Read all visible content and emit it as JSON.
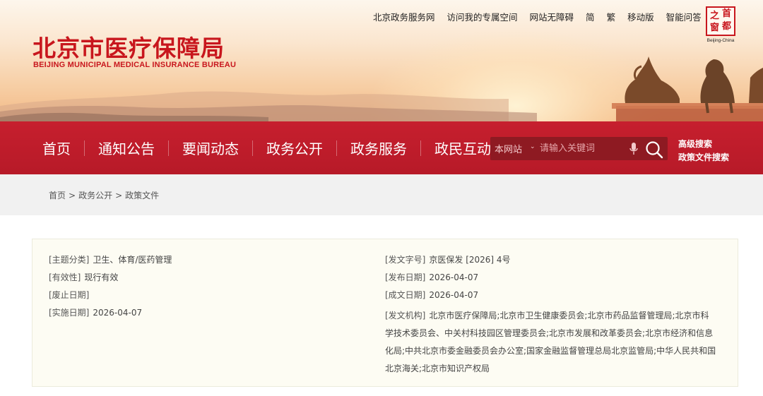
{
  "header": {
    "logo_cn": "北京市医疗保障局",
    "logo_en": "BEIJING MUNICIPAL MEDICAL INSURANCE BUREAU",
    "top_links": [
      "北京政务服务网",
      "访问我的专属空间",
      "网站无障碍",
      "简",
      "繁",
      "移动版",
      "智能问答"
    ],
    "seal": {
      "chars": [
        "首",
        "都",
        "之",
        "窗"
      ],
      "caption": "Beijing-China"
    }
  },
  "nav": {
    "items": [
      "首页",
      "通知公告",
      "要闻动态",
      "政务公开",
      "政务服务",
      "政民互动"
    ]
  },
  "search": {
    "scope": "本网站",
    "placeholder": "请输入关键词"
  },
  "advanced": {
    "search": "高级搜索",
    "policy_search": "政策文件搜索"
  },
  "breadcrumb": [
    "首页",
    "政务公开",
    "政策文件"
  ],
  "breadcrumb_sep": ">",
  "info": {
    "left": [
      {
        "label": "[主题分类]",
        "value": "卫生、体育/医药管理"
      },
      {
        "label": "[有效性]",
        "value": "现行有效"
      },
      {
        "label": "[废止日期]",
        "value": ""
      },
      {
        "label": "[实施日期]",
        "value": "2026-04-07"
      }
    ],
    "right": [
      {
        "label": "[发文字号]",
        "value": "京医保发 [2026] 4号"
      },
      {
        "label": "[发布日期]",
        "value": "2026-04-07"
      },
      {
        "label": "[成文日期]",
        "value": "2026-04-07"
      }
    ],
    "issuer": {
      "label": "[发文机构]",
      "value": "北京市医疗保障局;北京市卫生健康委员会;北京市药品监督管理局;北京市科学技术委员会、中关村科技园区管理委员会;北京市发展和改革委员会;北京市经济和信息化局;中共北京市委金融委员会办公室;国家金融监督管理总局北京监管局;中华人民共和国北京海关;北京市知识产权局"
    }
  },
  "colors": {
    "brand_red": "#c8161d",
    "nav_red": "#c61f2e",
    "search_bg": "#8e1a22",
    "card_bg": "#fdfcf3"
  },
  "icons": {
    "mic": "microphone-icon",
    "search": "search-icon"
  }
}
